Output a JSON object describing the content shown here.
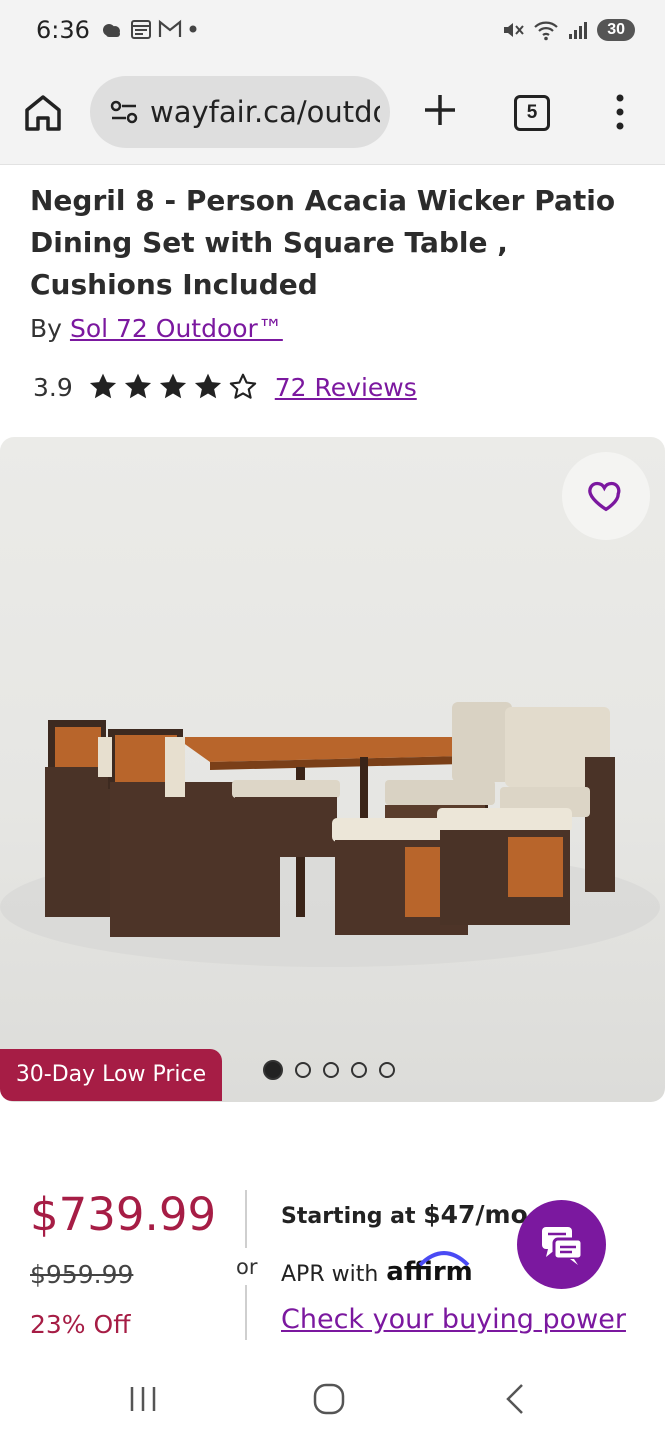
{
  "status_bar": {
    "time": "6:36",
    "battery": "30"
  },
  "browser": {
    "url": "wayfair.ca/outdoor",
    "tab_count": "5"
  },
  "product": {
    "title": "Negril 8 - Person Acacia Wicker Patio Dining Set with Square Table , Cushions Included",
    "by_prefix": "By",
    "brand": "Sol 72 Outdoor™",
    "rating": "3.9",
    "stars_filled": 4,
    "stars_total": 5,
    "reviews_link": "72 Reviews"
  },
  "gallery": {
    "badge": "30-Day Low Price",
    "image_count": 5,
    "active_index": 0
  },
  "pricing": {
    "price": "$739.99",
    "old_price": "$959.99",
    "discount": "23% Off",
    "or_label": "or",
    "starting_prefix": "Starting at ",
    "monthly": "$47/mo.",
    "apr_text": "APR with",
    "affirm_logo": "affirm",
    "buying_power": "Check your buying power"
  },
  "colors": {
    "brand_purple": "#7b189f",
    "sale_red": "#a61d45"
  }
}
